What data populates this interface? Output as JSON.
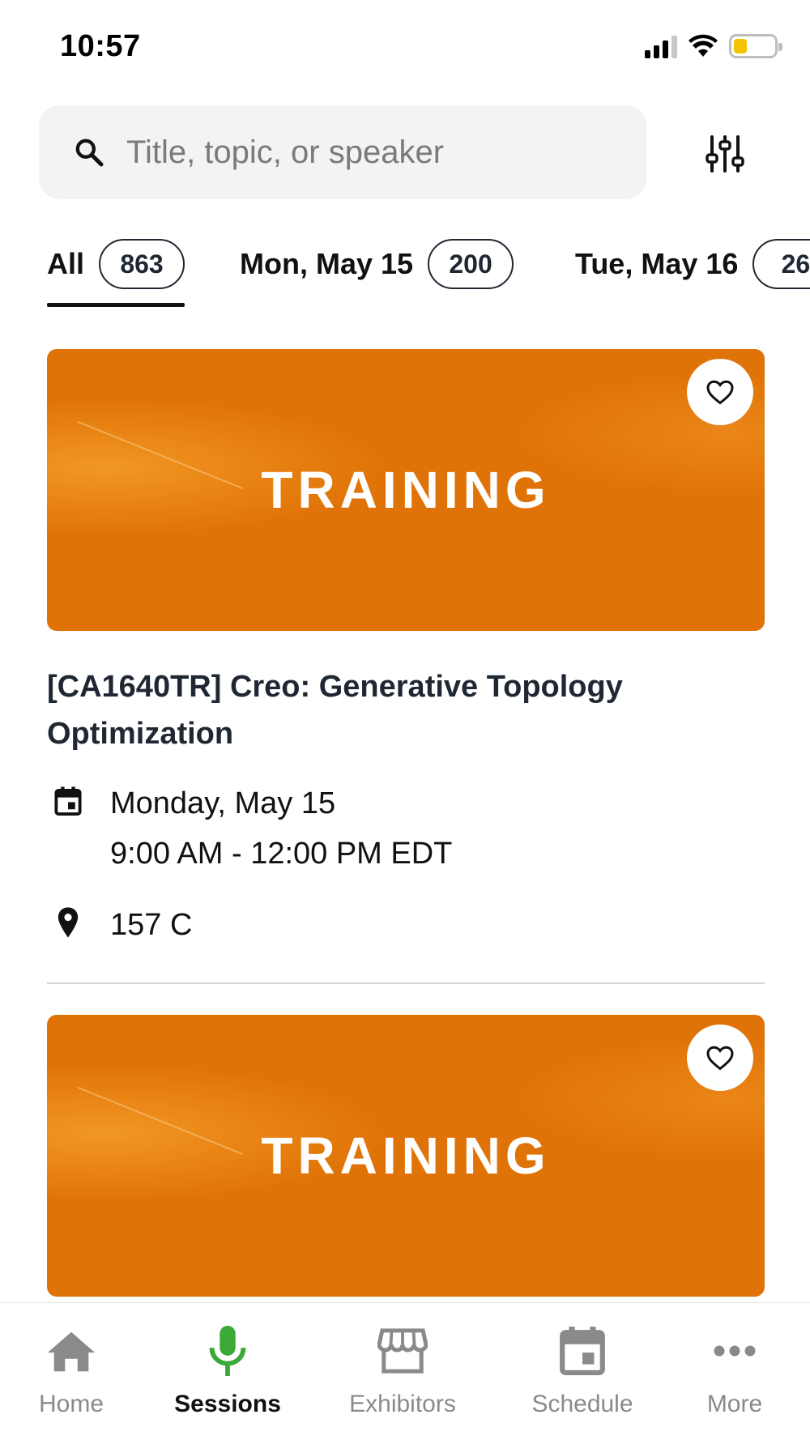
{
  "status_bar": {
    "time": "10:57"
  },
  "search": {
    "placeholder": "Title, topic, or speaker",
    "value": ""
  },
  "tabs": [
    {
      "label": "All",
      "count": "863",
      "selected": true
    },
    {
      "label": "Mon, May 15",
      "count": "200",
      "selected": false
    },
    {
      "label": "Tue, May 16",
      "count": "26",
      "selected": false
    }
  ],
  "sessions": [
    {
      "banner_text": "TRAINING",
      "title": "[CA1640TR] Creo: Generative Topology Optimization",
      "date": "Monday, May 15",
      "time": "9:00 AM - 12:00 PM EDT",
      "location": "157 C"
    },
    {
      "banner_text": "TRAINING"
    }
  ],
  "bottom_nav": [
    {
      "label": "Home",
      "icon": "home-icon",
      "active": false
    },
    {
      "label": "Sessions",
      "icon": "microphone-icon",
      "active": true
    },
    {
      "label": "Exhibitors",
      "icon": "storefront-icon",
      "active": false
    },
    {
      "label": "Schedule",
      "icon": "calendar-icon",
      "active": false
    },
    {
      "label": "More",
      "icon": "more-dots-icon",
      "active": false
    }
  ],
  "colors": {
    "accent_active_nav": "#3aa935",
    "banner_orange": "#e07307",
    "text_dark": "#1f2733",
    "inactive_nav": "#8a8a8a"
  }
}
